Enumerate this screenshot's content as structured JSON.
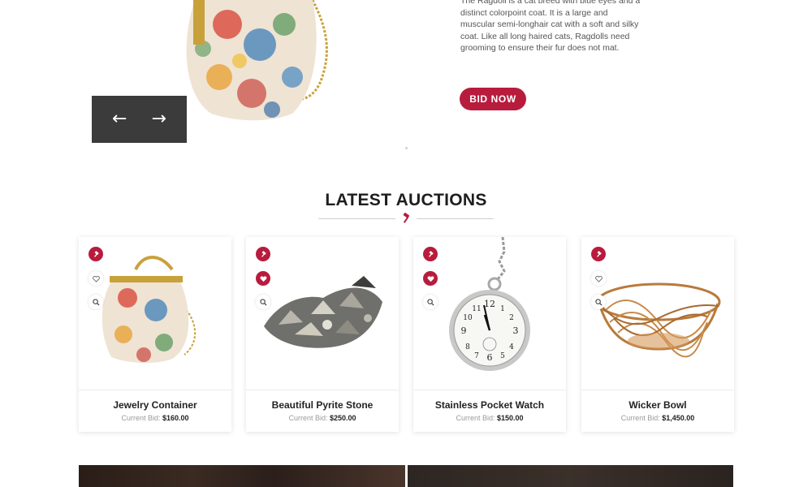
{
  "hero": {
    "description": "The Ragdoll is a cat breed with blue eyes and a distinct colorpoint coat. It is a large and muscular semi-longhair cat with a soft and silky coat. Like all long haired cats, Ragdolls need grooming to ensure their fur does not mat.",
    "bid_button": "BID NOW",
    "prev_arrow": "←",
    "next_arrow": "→"
  },
  "section": {
    "title": "LATEST AUCTIONS"
  },
  "cards": [
    {
      "title": "Jewelry Container",
      "bid_label": "Current Bid:",
      "price": "$160.00"
    },
    {
      "title": "Beautiful Pyrite Stone",
      "bid_label": "Current Bid:",
      "price": "$250.00"
    },
    {
      "title": "Stainless Pocket Watch",
      "bid_label": "Current Bid:",
      "price": "$150.00"
    },
    {
      "title": "Wicker Bowl",
      "bid_label": "Current Bid:",
      "price": "$1,450.00"
    }
  ],
  "colors": {
    "accent": "#b81c3d",
    "nav_dark": "#3b3b3b"
  },
  "icons": [
    "gavel-icon",
    "heart-icon",
    "search-icon",
    "arrow-left-icon",
    "arrow-right-icon"
  ]
}
